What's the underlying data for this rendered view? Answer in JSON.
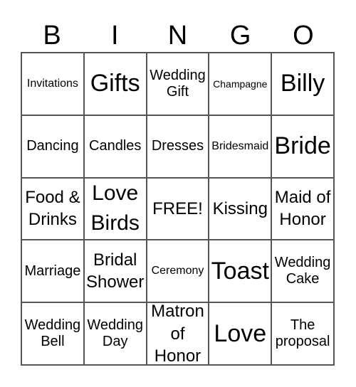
{
  "header": [
    "B",
    "I",
    "N",
    "G",
    "O"
  ],
  "cells": [
    {
      "text": "Invitations",
      "size": "s1"
    },
    {
      "text": "Gifts",
      "size": "s4"
    },
    {
      "text": "Wedding Gift",
      "size": "s1w"
    },
    {
      "text": "Champagne",
      "size": "s5"
    },
    {
      "text": "Billy",
      "size": "s4"
    },
    {
      "text": "Dancing",
      "size": "s2"
    },
    {
      "text": "Candles",
      "size": "s2"
    },
    {
      "text": "Dresses",
      "size": "s2"
    },
    {
      "text": "Bridesmaid",
      "size": "s1"
    },
    {
      "text": "Bride",
      "size": "s4"
    },
    {
      "text": "Food & Drinks",
      "size": "s3"
    },
    {
      "text": "Love Birds",
      "size": "s6"
    },
    {
      "text": "FREE!",
      "size": "s3"
    },
    {
      "text": "Kissing",
      "size": "s3"
    },
    {
      "text": "Maid of Honor",
      "size": "s3"
    },
    {
      "text": "Marriage",
      "size": "s2"
    },
    {
      "text": "Bridal Shower",
      "size": "s3"
    },
    {
      "text": "Ceremony",
      "size": "s1"
    },
    {
      "text": "Toast",
      "size": "s4"
    },
    {
      "text": "Wedding Cake",
      "size": "s2"
    },
    {
      "text": "Wedding Bell",
      "size": "s2"
    },
    {
      "text": "Wedding Day",
      "size": "s2"
    },
    {
      "text": "Matron of Honor",
      "size": "s3"
    },
    {
      "text": "Love",
      "size": "s4"
    },
    {
      "text": "The proposal",
      "size": "s2"
    }
  ]
}
